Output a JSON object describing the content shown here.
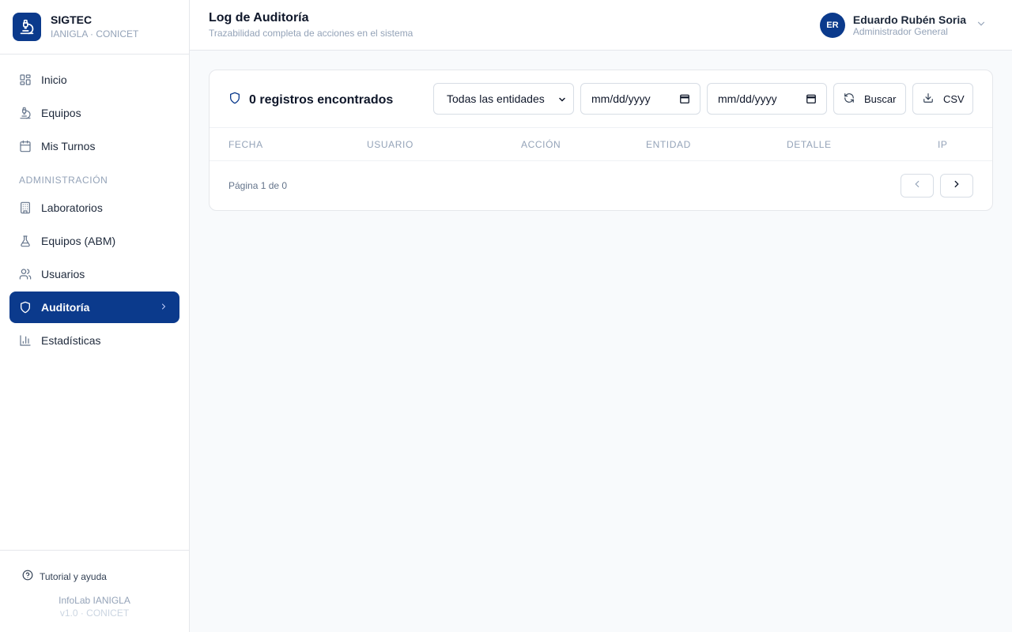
{
  "brand": {
    "name": "SIGTEC",
    "subtitle": "IANIGLA · CONICET",
    "logo_icon": "microscope-icon"
  },
  "sidebar": {
    "main_items": [
      {
        "label": "Inicio",
        "icon": "grid-icon"
      },
      {
        "label": "Equipos",
        "icon": "microscope-icon"
      },
      {
        "label": "Mis Turnos",
        "icon": "calendar-icon"
      }
    ],
    "section_label": "ADMINISTRACIÓN",
    "admin_items": [
      {
        "label": "Laboratorios",
        "icon": "building-icon"
      },
      {
        "label": "Equipos (ABM)",
        "icon": "flask-icon"
      },
      {
        "label": "Usuarios",
        "icon": "users-icon"
      },
      {
        "label": "Auditoría",
        "icon": "shield-icon",
        "active": true
      },
      {
        "label": "Estadísticas",
        "icon": "bar-chart-icon"
      }
    ],
    "help_label": "Tutorial y ayuda",
    "footer_line1": "InfoLab IANIGLA",
    "footer_line2": "v1.0 · CONICET"
  },
  "header": {
    "title": "Log de Auditoría",
    "subtitle": "Trazabilidad completa de acciones en el sistema",
    "user": {
      "initials": "ER",
      "name": "Eduardo Rubén Soria",
      "role": "Administrador General"
    }
  },
  "audit": {
    "count_label": "0 registros encontrados",
    "entity_select_value": "Todas las entidades",
    "date_from_placeholder": "mm/dd/yyyy",
    "date_to_placeholder": "mm/dd/yyyy",
    "search_label": "Buscar",
    "csv_label": "CSV",
    "columns": [
      "FECHA",
      "USUARIO",
      "ACCIÓN",
      "ENTIDAD",
      "DETALLE",
      "IP"
    ],
    "rows": [],
    "pagination_text": "Página 1 de 0"
  },
  "colors": {
    "primary": "#0b3a8c",
    "sidebar_bg": "#ffffff",
    "page_bg": "#f8fafc",
    "muted_text": "#94a3b8"
  }
}
